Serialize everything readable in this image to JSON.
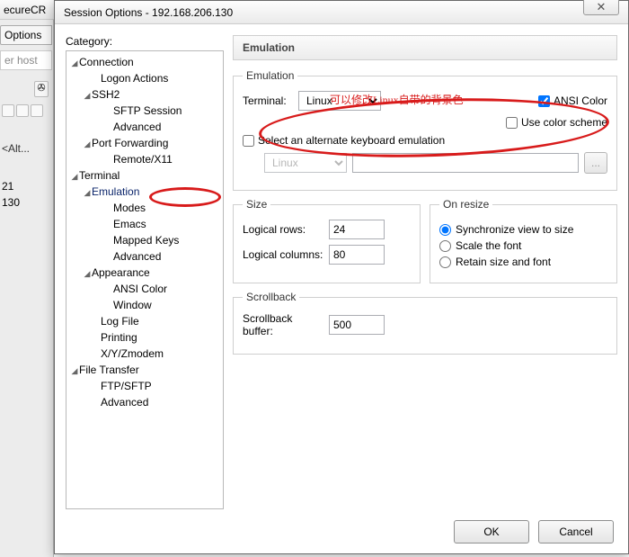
{
  "bg": {
    "app_title": "ecureCR",
    "options_tab": "Options",
    "host_field": "er host",
    "alt": "<Alt...",
    "n21": "21",
    "n130": "130",
    "pin": "✇"
  },
  "dialog": {
    "title": "Session Options - 192.168.206.130",
    "close": "✕",
    "category_label": "Category:"
  },
  "tree": {
    "connection": "Connection",
    "logon_actions": "Logon Actions",
    "ssh2": "SSH2",
    "sftp_session": "SFTP Session",
    "advanced1": "Advanced",
    "port_fwd": "Port Forwarding",
    "remote_x11": "Remote/X11",
    "terminal": "Terminal",
    "emulation": "Emulation",
    "modes": "Modes",
    "emacs": "Emacs",
    "mapped_keys": "Mapped Keys",
    "advanced2": "Advanced",
    "appearance": "Appearance",
    "ansi_color": "ANSI Color",
    "window": "Window",
    "log_file": "Log File",
    "printing": "Printing",
    "xyzmodem": "X/Y/Zmodem",
    "file_transfer": "File Transfer",
    "ftp_sftp": "FTP/SFTP",
    "advanced3": "Advanced"
  },
  "panel": {
    "header": "Emulation",
    "emu_legend": "Emulation",
    "terminal_label": "Terminal:",
    "terminal_value": "Linux",
    "ansi_color": "ANSI Color",
    "use_color_scheme": "Use color scheme",
    "alt_kb": "Select an alternate keyboard emulation",
    "alt_kb_value": "Linux",
    "browse": "...",
    "size_legend": "Size",
    "rows_label": "Logical rows:",
    "rows_value": "24",
    "cols_label": "Logical columns:",
    "cols_value": "80",
    "resize_legend": "On resize",
    "r_sync": "Synchronize view to size",
    "r_scalefont": "Scale the font",
    "r_retain": "Retain size and font",
    "scroll_legend": "Scrollback",
    "scroll_label": "Scrollback buffer:",
    "scroll_value": "500"
  },
  "annotation": {
    "text": "可以修改Linux自带的背景色"
  },
  "buttons": {
    "ok": "OK",
    "cancel": "Cancel"
  }
}
